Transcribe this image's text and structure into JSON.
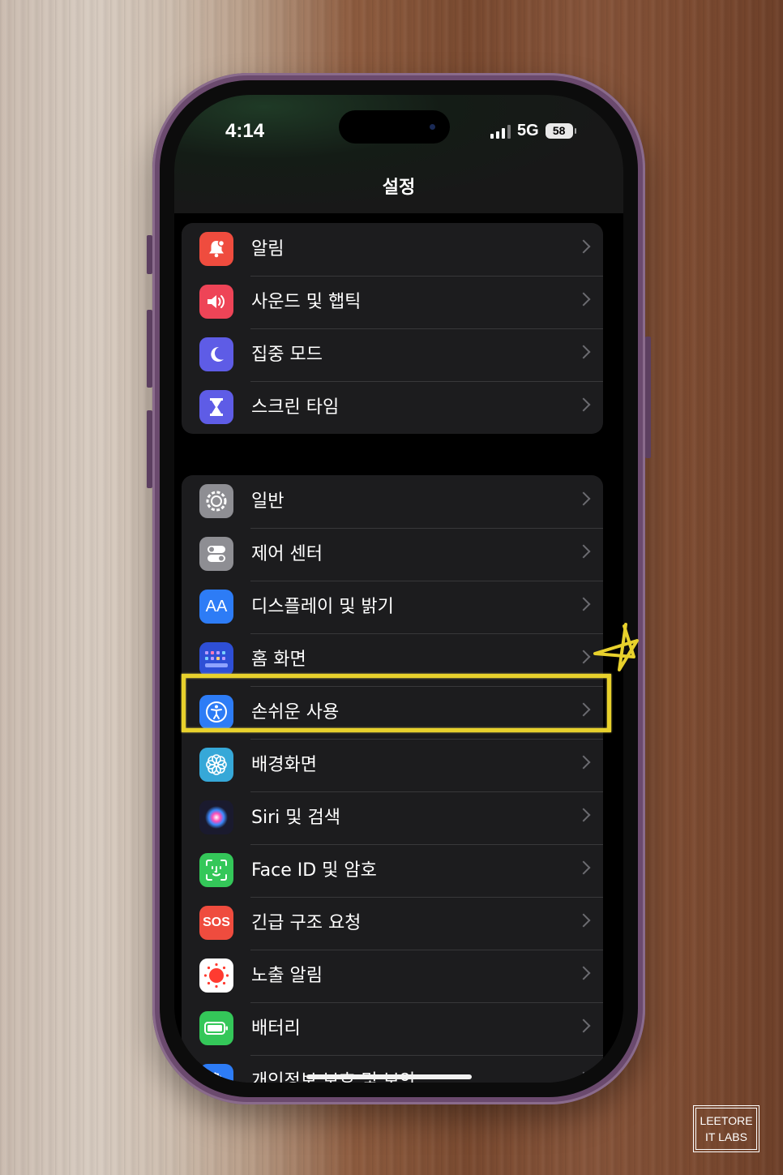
{
  "status_bar": {
    "time": "4:14",
    "network": "5G",
    "battery": "58"
  },
  "header": {
    "title": "설정"
  },
  "groups": [
    {
      "items": [
        {
          "label": "알림",
          "icon": "bell-icon",
          "color": "#ef4c3e"
        },
        {
          "label": "사운드 및 햅틱",
          "icon": "speaker-icon",
          "color": "#ee4457"
        },
        {
          "label": "집중 모드",
          "icon": "moon-icon",
          "color": "#5e5ce6"
        },
        {
          "label": "스크린 타임",
          "icon": "hourglass-icon",
          "color": "#5e5ce6"
        }
      ]
    },
    {
      "items": [
        {
          "label": "일반",
          "icon": "gear-icon",
          "color": "#8e8e93"
        },
        {
          "label": "제어 센터",
          "icon": "toggles-icon",
          "color": "#8e8e93"
        },
        {
          "label": "디스플레이 및 밝기",
          "icon": "text-size-icon",
          "color": "#2d7cf6",
          "glyph": "AA"
        },
        {
          "label": "홈 화면",
          "icon": "home-grid-icon",
          "color": "#2e4fd6"
        },
        {
          "label": "손쉬운 사용",
          "icon": "accessibility-icon",
          "color": "#2d7cf6"
        },
        {
          "label": "배경화면",
          "icon": "flower-icon",
          "color": "#36a8d8"
        },
        {
          "label": "Siri 및 검색",
          "icon": "siri-icon",
          "color": "#1a1a2e"
        },
        {
          "label": "Face ID 및 암호",
          "icon": "face-id-icon",
          "color": "#34c759"
        },
        {
          "label": "긴급 구조 요청",
          "icon": "sos-icon",
          "color": "#ef4c3e",
          "glyph": "SOS"
        },
        {
          "label": "노출 알림",
          "icon": "exposure-icon",
          "color": "#ffffff"
        },
        {
          "label": "배터리",
          "icon": "battery-icon",
          "color": "#34c759"
        },
        {
          "label": "개인정보 보호 및 보안",
          "icon": "hand-icon",
          "color": "#2d7cf6"
        }
      ]
    }
  ],
  "annotation": {
    "highlight_color": "#e8d12c",
    "highlighted_item": "손쉬운 사용"
  },
  "watermark": {
    "line1": "LEETORE",
    "line2": "IT LABS"
  }
}
